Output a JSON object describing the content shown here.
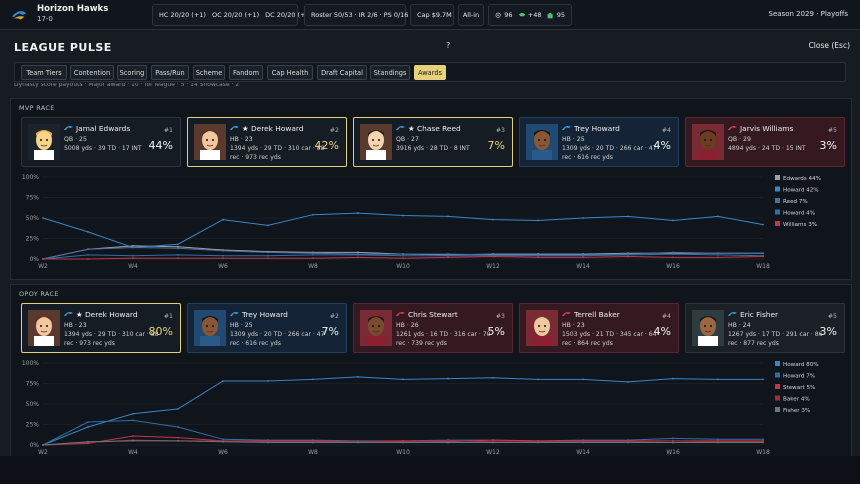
{
  "topbar": {
    "team_name": "Horizon Hawks",
    "record": "17-0",
    "coaches": [
      "HC 20/20 (+1)",
      "OC 20/20 (+1)",
      "DC 20/20 (+1)"
    ],
    "roster": [
      "Roster 50/53",
      "IR 2/6",
      "PS 0/16"
    ],
    "roster_sep": "·",
    "cap": "Cap $9.7M",
    "mode": "All-in",
    "metric_1": "96",
    "metric_2": "+48",
    "metric_3": "95",
    "season": "Season 2029 · Playoffs"
  },
  "modal": {
    "title": "LEAGUE PULSE",
    "help": "?",
    "close": "Close (Esc)",
    "subline": "Dynasty score payouts · Major award · 10 · for league · 5 · 14 Showcase · 2"
  },
  "tabs": [
    "Team Tiers",
    "Contention",
    "Scoring",
    "Pass/Run",
    "Scheme",
    "Fandom",
    "Cap Health",
    "Draft Capital",
    "Standings",
    "Awards"
  ],
  "active_tab": "Awards",
  "colors": {
    "accent_gold": "#e6d27a",
    "blue": "#3a86c8",
    "red": "#c2364a",
    "gray": "#9aa3ad"
  },
  "sections": [
    {
      "title": "MVP RACE",
      "cards": [
        {
          "name": "Jamal Edwards",
          "star": false,
          "pos": "QB · 25",
          "stats": "5008 yds · 39 TD · 17 INT",
          "rank": "#1",
          "pct": "44%",
          "style": "plain",
          "icon": "team-icon"
        },
        {
          "name": "★ Derek Howard",
          "star": true,
          "pos": "HB · 23",
          "stats": "1394 yds · 29 TD · 310 car · 88 rec · 973 rec yds",
          "rank": "#2",
          "pct": "42%",
          "style": "gold",
          "icon": "team-icon"
        },
        {
          "name": "★ Chase Reed",
          "star": true,
          "pos": "QB · 27",
          "stats": "3916 yds · 28 TD · 8 INT",
          "rank": "#3",
          "pct": "7%",
          "style": "gold",
          "icon": "team-icon"
        },
        {
          "name": "Trey Howard",
          "star": false,
          "pos": "HB · 25",
          "stats": "1309 yds · 20 TD · 266 car · 47 rec · 616 rec yds",
          "rank": "#4",
          "pct": "4%",
          "style": "blue",
          "icon": "team-icon"
        },
        {
          "name": "Jarvis Williams",
          "star": false,
          "pos": "QB · 29",
          "stats": "4894 yds · 24 TD · 15 INT",
          "rank": "#5",
          "pct": "3%",
          "style": "red",
          "icon": "team-icon"
        }
      ]
    },
    {
      "title": "OPOY RACE",
      "cards": [
        {
          "name": "★ Derek Howard",
          "star": true,
          "pos": "HB · 23",
          "stats": "1394 yds · 29 TD · 310 car · 88 rec · 973 rec yds",
          "rank": "#1",
          "pct": "80%",
          "style": "gold",
          "icon": "team-icon"
        },
        {
          "name": "Trey Howard",
          "star": false,
          "pos": "HB · 25",
          "stats": "1309 yds · 20 TD · 266 car · 47 rec · 616 rec yds",
          "rank": "#2",
          "pct": "7%",
          "style": "blue",
          "icon": "team-icon"
        },
        {
          "name": "Chris Stewart",
          "star": false,
          "pos": "HB · 26",
          "stats": "1261 yds · 16 TD · 316 car · 70 rec · 739 rec yds",
          "rank": "#3",
          "pct": "5%",
          "style": "red",
          "icon": "team-icon"
        },
        {
          "name": "Terrell Baker",
          "star": false,
          "pos": "HB · 23",
          "stats": "1503 yds · 21 TD · 345 car · 64 rec · 864 rec yds",
          "rank": "#4",
          "pct": "4%",
          "style": "red",
          "icon": "team-icon"
        },
        {
          "name": "Eric Fisher",
          "star": false,
          "pos": "HB · 24",
          "stats": "1267 yds · 17 TD · 291 car · 86 rec · 877 rec yds",
          "rank": "#5",
          "pct": "3%",
          "style": "dark",
          "icon": "team-icon"
        }
      ]
    }
  ],
  "chart_data": [
    {
      "type": "line",
      "title": "",
      "x": [
        "W2",
        "W3",
        "W4",
        "W5",
        "W6",
        "W7",
        "W8",
        "W9",
        "W10",
        "W11",
        "W12",
        "W13",
        "W14",
        "W15",
        "W16",
        "W17",
        "W18"
      ],
      "xticks": [
        "W2",
        "W4",
        "W6",
        "W8",
        "W10",
        "W12",
        "W14",
        "W16",
        "W18"
      ],
      "yticks": [
        "0%",
        "25%",
        "50%",
        "75%",
        "100%"
      ],
      "ylim": [
        0,
        100
      ],
      "legend_position": "right",
      "series": [
        {
          "name": "Edwards 44%",
          "color": "#9aa3ad",
          "values": [
            0,
            12,
            16,
            15,
            11,
            9,
            8,
            8,
            6,
            5,
            6,
            6,
            6,
            7,
            7,
            7,
            7
          ]
        },
        {
          "name": "Howard 42%",
          "color": "#3a86c8",
          "values": [
            50,
            33,
            14,
            18,
            48,
            41,
            54,
            56,
            53,
            52,
            48,
            47,
            50,
            52,
            47,
            52,
            42
          ]
        },
        {
          "name": "Reed 7%",
          "color": "#4d6fa3",
          "values": [
            0,
            12,
            14,
            13,
            10,
            8,
            7,
            6,
            6,
            6,
            5,
            5,
            5,
            6,
            8,
            7,
            7
          ]
        },
        {
          "name": "Howard 4%",
          "color": "#2f6fa6",
          "values": [
            0,
            5,
            4,
            5,
            4,
            4,
            5,
            5,
            4,
            4,
            4,
            4,
            4,
            5,
            6,
            5,
            4
          ]
        },
        {
          "name": "Williams 3%",
          "color": "#c2364a",
          "values": [
            0,
            0,
            1,
            1,
            1,
            1,
            1,
            2,
            1,
            2,
            3,
            2,
            2,
            3,
            2,
            2,
            3
          ]
        }
      ]
    },
    {
      "type": "line",
      "title": "",
      "x": [
        "W2",
        "W3",
        "W4",
        "W5",
        "W6",
        "W7",
        "W8",
        "W9",
        "W10",
        "W11",
        "W12",
        "W13",
        "W14",
        "W15",
        "W16",
        "W17",
        "W18"
      ],
      "xticks": [
        "W2",
        "W4",
        "W6",
        "W8",
        "W10",
        "W12",
        "W14",
        "W16",
        "W18"
      ],
      "yticks": [
        "0%",
        "25%",
        "50%",
        "75%",
        "100%"
      ],
      "ylim": [
        0,
        100
      ],
      "legend_position": "right",
      "series": [
        {
          "name": "Howard 80%",
          "color": "#3a86c8",
          "values": [
            0,
            22,
            38,
            44,
            78,
            78,
            80,
            83,
            80,
            81,
            82,
            80,
            80,
            77,
            81,
            80,
            80
          ]
        },
        {
          "name": "Howard 7%",
          "color": "#2f6fa6",
          "values": [
            0,
            28,
            30,
            22,
            7,
            6,
            6,
            5,
            5,
            6,
            6,
            5,
            6,
            6,
            8,
            7,
            7
          ]
        },
        {
          "name": "Stewart 5%",
          "color": "#c2364a",
          "values": [
            0,
            2,
            11,
            9,
            5,
            5,
            5,
            4,
            5,
            4,
            6,
            5,
            5,
            5,
            5,
            5,
            5
          ]
        },
        {
          "name": "Baker 4%",
          "color": "#a52a3c",
          "values": [
            0,
            3,
            6,
            5,
            5,
            4,
            4,
            4,
            4,
            5,
            4,
            4,
            4,
            4,
            3,
            4,
            4
          ]
        },
        {
          "name": "Fisher 3%",
          "color": "#6b7680",
          "values": [
            0,
            4,
            5,
            5,
            4,
            3,
            3,
            3,
            3,
            3,
            3,
            3,
            3,
            3,
            3,
            3,
            3
          ]
        }
      ]
    }
  ]
}
